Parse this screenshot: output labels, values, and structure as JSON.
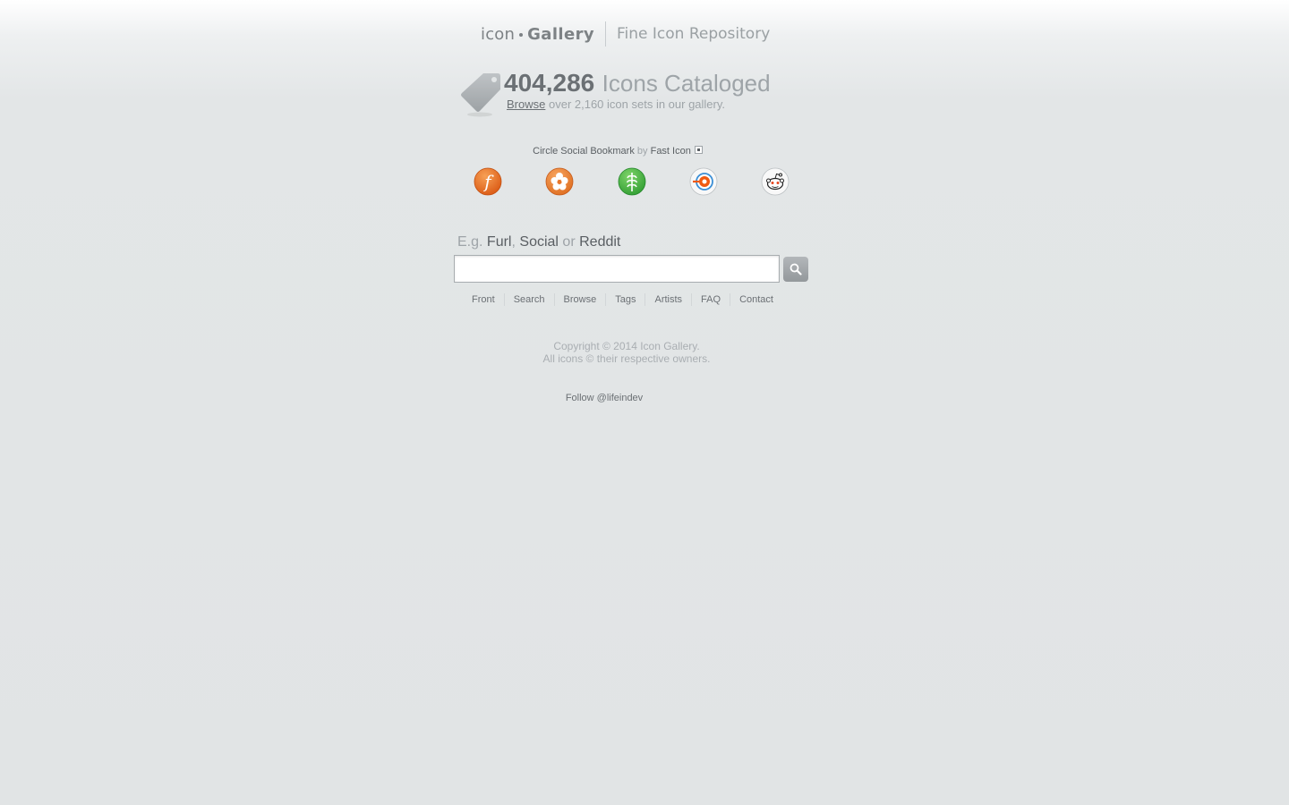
{
  "header": {
    "logo_icon_word": "icon",
    "logo_gallery_word": "Gallery",
    "tagline": "Fine Icon Repository"
  },
  "stats": {
    "count": "404,286",
    "label": "Icons Cataloged",
    "browse_link": "Browse",
    "browse_suffix": "over 2,160 icon sets in our gallery."
  },
  "featured": {
    "set_name": "Circle Social Bookmark",
    "by_word": "by",
    "artist": "Fast Icon",
    "icons": [
      {
        "name": "furl-icon",
        "color": "#e8691a"
      },
      {
        "name": "ma-gnolia-icon",
        "color": "#ea7a2c"
      },
      {
        "name": "newsvine-icon",
        "color": "#3aa93a"
      },
      {
        "name": "blinklist-icon",
        "color": "#ffffff"
      },
      {
        "name": "reddit-icon",
        "color": "#ffffff"
      }
    ]
  },
  "search": {
    "hint_prefix": "E.g.",
    "kw1": "Furl",
    "sep1": ",",
    "kw2": "Social",
    "sep2": "or",
    "kw3": "Reddit",
    "placeholder": "",
    "value": ""
  },
  "nav": {
    "items": [
      "Front",
      "Search",
      "Browse",
      "Tags",
      "Artists",
      "FAQ",
      "Contact"
    ]
  },
  "footer": {
    "copyright_line1": "Copyright © 2014 Icon Gallery.",
    "copyright_line2": "All icons © their respective owners.",
    "follow": "Follow @lifeindev"
  }
}
